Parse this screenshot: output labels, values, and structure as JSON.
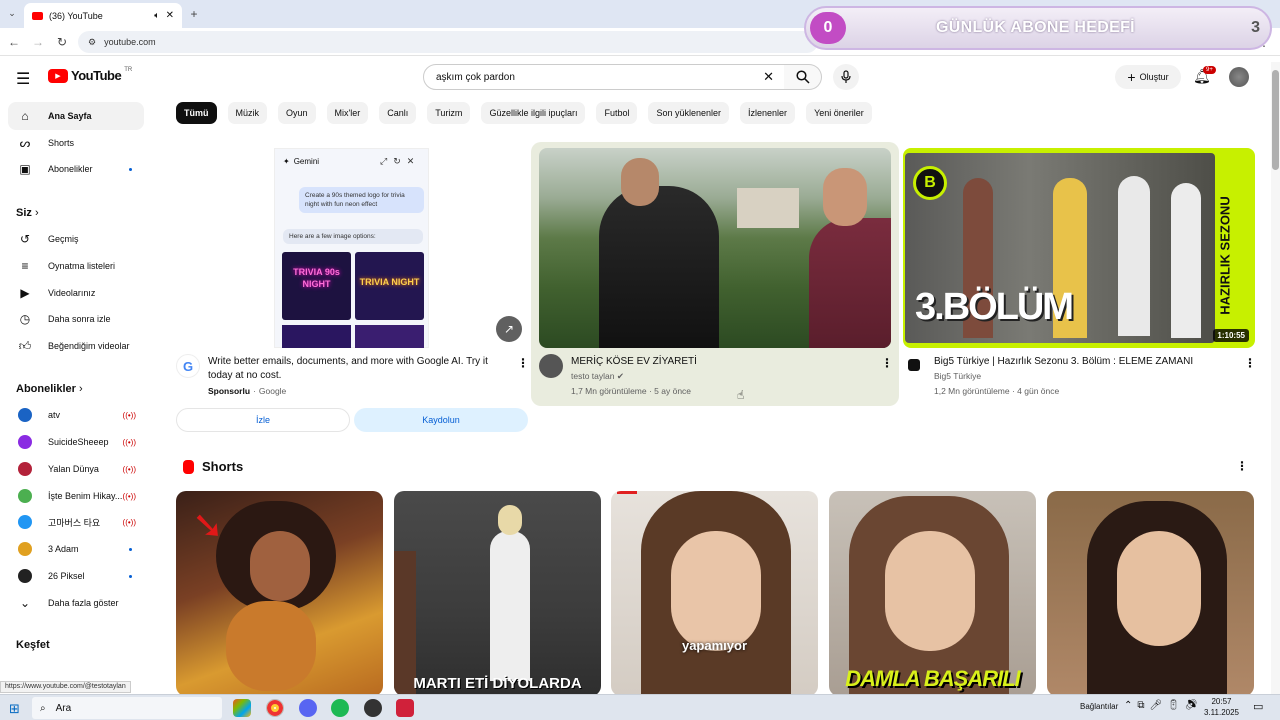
{
  "browser": {
    "tab_title": "(36) YouTube",
    "url": "youtube.com",
    "status_url": "https://www.youtube.com/@testotaylan"
  },
  "overlay": {
    "current": "0",
    "title": "GÜNLÜK ABONE HEDEFİ",
    "target": "3"
  },
  "masthead": {
    "logo": "YouTube",
    "logo_region": "TR",
    "search_value": "aşkım çok pardon",
    "create_label": "Oluştur",
    "notifications_badge": "9+"
  },
  "sidebar": {
    "main": [
      {
        "label": "Ana Sayfa",
        "icon": "home-icon"
      },
      {
        "label": "Shorts",
        "icon": "shorts-icon"
      },
      {
        "label": "Abonelikler",
        "icon": "subscriptions-icon"
      }
    ],
    "you_header": "Siz",
    "you": [
      {
        "label": "Geçmiş",
        "icon": "history-icon"
      },
      {
        "label": "Oynatma listeleri",
        "icon": "playlist-icon"
      },
      {
        "label": "Videolarınız",
        "icon": "video-icon"
      },
      {
        "label": "Daha sonra izle",
        "icon": "clock-icon"
      },
      {
        "label": "Beğendiğim videolar",
        "icon": "like-icon"
      }
    ],
    "subs_header": "Abonelikler",
    "subs": [
      {
        "label": "atv",
        "color": "#1a63c4",
        "status": "live"
      },
      {
        "label": "SuicideSheeep",
        "color": "#8a2be2",
        "status": "live"
      },
      {
        "label": "Yalan Dünya",
        "color": "#b3223a",
        "status": "live"
      },
      {
        "label": "İşte Benim Hikay...",
        "color": "#4caf50",
        "status": "live"
      },
      {
        "label": "고마버스 타요",
        "color": "#2196f3",
        "status": "live"
      },
      {
        "label": "3 Adam",
        "color": "#e0a020",
        "status": "new"
      },
      {
        "label": "26 Piksel",
        "color": "#222222",
        "status": "new"
      }
    ],
    "more_label": "Daha fazla göster",
    "explore_header": "Keşfet"
  },
  "chips": [
    "Tümü",
    "Müzik",
    "Oyun",
    "Mix'ler",
    "Canlı",
    "Turizm",
    "Güzellikle ilgili ipuçları",
    "Futbol",
    "Son yüklenenler",
    "İzlenenler",
    "Yeni öneriler"
  ],
  "ad": {
    "gemini_title": "Gemini",
    "prompt": "Create a 90s themed logo for trivia night with fun neon effect",
    "reply": "Here are a few image options:",
    "tile1": "TRIVIA 90s NIGHT",
    "tile2": "TRIVIA NIGHT",
    "title": "Write better emails, documents, and more with Google AI. Try it today at no cost.",
    "sponsor": "Sponsorlu",
    "advertiser": "Google",
    "watch_label": "İzle",
    "signup_label": "Kaydolun"
  },
  "videos": [
    {
      "title": "MERİÇ KÖSE EV ZİYARETİ",
      "channel": "testo taylan",
      "views": "1,7 Mn görüntüleme",
      "age": "5 ay önce",
      "duration": ""
    },
    {
      "title": "Big5 Türkiye | Hazırlık Sezonu 3. Bölüm : ELEME ZAMANI",
      "channel": "Big5 Türkiye",
      "views": "1,2 Mn görüntüleme",
      "age": "4 gün önce",
      "duration": "1:10:55",
      "thumb_text": "3.BÖLÜM",
      "thumb_side": "HAZIRLIK SEZONU"
    }
  ],
  "shorts": {
    "header": "Shorts",
    "items": [
      {
        "caption": ""
      },
      {
        "caption": "MARTI ETİ DİYOLARDA"
      },
      {
        "caption": "yapamıyor"
      },
      {
        "caption": "DAMLA BAŞARILI"
      },
      {
        "caption": ""
      }
    ]
  },
  "taskbar": {
    "search_placeholder": "Ara",
    "network_label": "Bağlantılar",
    "time": "20:57",
    "date": "3.11.2025"
  }
}
